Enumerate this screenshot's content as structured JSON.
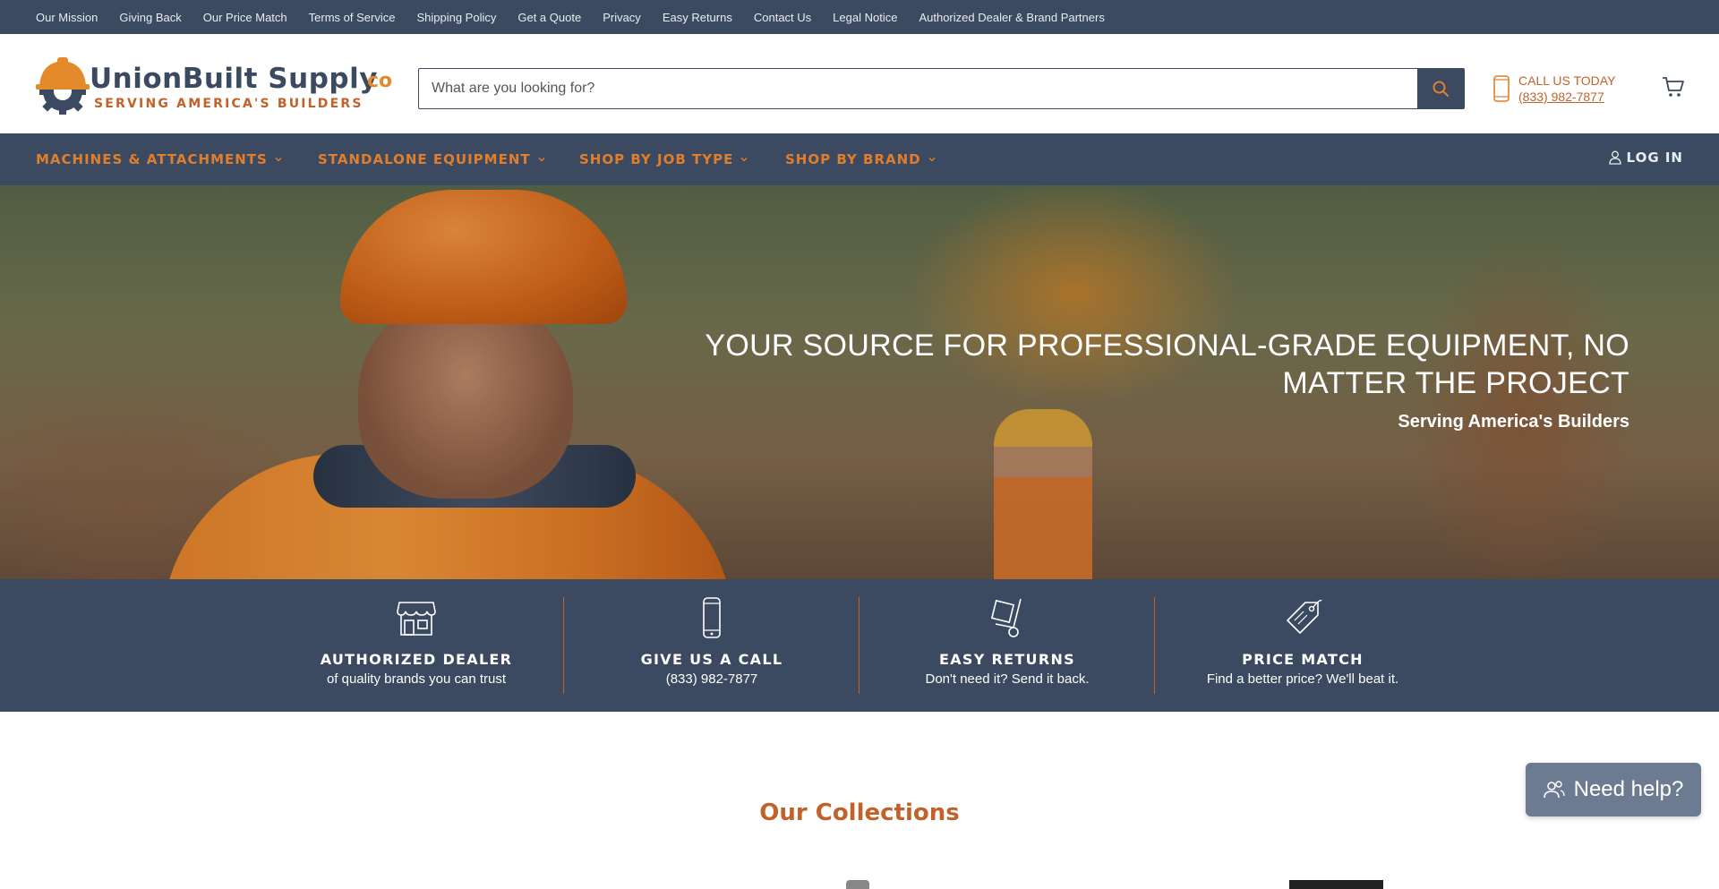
{
  "topbar": {
    "links": [
      "Our Mission",
      "Giving Back",
      "Our Price Match",
      "Terms of Service",
      "Shipping Policy",
      "Get a Quote",
      "Privacy",
      "Easy Returns",
      "Contact Us",
      "Legal Notice",
      "Authorized Dealer & Brand Partners"
    ]
  },
  "header": {
    "logo_main": "UnionBuilt Supply",
    "logo_co": "co",
    "logo_tagline": "SERVING AMERICA'S BUILDERS",
    "search_placeholder": "What are you looking for?",
    "call_label": "CALL US TODAY",
    "call_number": "(833) 982-7877"
  },
  "nav": {
    "items": [
      "MACHINES & ATTACHMENTS",
      "STANDALONE EQUIPMENT",
      "SHOP BY JOB TYPE",
      "SHOP BY BRAND"
    ],
    "login": "LOG IN"
  },
  "hero": {
    "title_line1": "YOUR SOURCE FOR PROFESSIONAL-GRADE EQUIPMENT, NO",
    "title_line2": "MATTER THE PROJECT",
    "subtitle": "Serving America's Builders"
  },
  "features": [
    {
      "icon": "storefront-icon",
      "title": "AUTHORIZED DEALER",
      "desc": "of quality brands you can trust"
    },
    {
      "icon": "phone-icon",
      "title": "GIVE US A CALL",
      "desc": "(833) 982-7877"
    },
    {
      "icon": "hand-truck-icon",
      "title": "EASY RETURNS",
      "desc": "Don't need it? Send it back."
    },
    {
      "icon": "price-tag-icon",
      "title": "PRICE MATCH",
      "desc": "Find a better price? We'll beat it."
    }
  ],
  "collections": {
    "title": "Our Collections"
  },
  "help": {
    "label": "Need help?"
  },
  "colors": {
    "navy": "#3b4a60",
    "orange": "#c2622b",
    "nav_orange": "#e07e2e"
  }
}
